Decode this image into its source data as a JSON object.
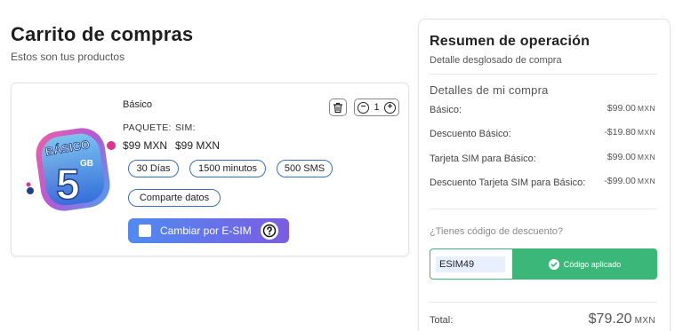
{
  "header": {
    "title": "Carrito de compras",
    "subtitle": "Estos son tus productos"
  },
  "product": {
    "name": "Básico",
    "image_text": {
      "line1": "BÁSICO",
      "big": "5",
      "unit": "GB"
    },
    "quantity": "1",
    "package_label": "PAQUETE:",
    "package_price": "$99 MXN",
    "sim_label": "SIM:",
    "sim_price": "$99 MXN",
    "features": [
      "30 Días",
      "1500 minutos",
      "500 SMS",
      "Comparte datos"
    ],
    "esim_label": "Cambiar por E-SIM",
    "esim_checked": false
  },
  "summary": {
    "title": "Resumen de operación",
    "subtitle": "Detalle desglosado de compra",
    "details_title": "Detalles de mi compra",
    "lines": [
      {
        "label": "Básico:",
        "amount": "$99.00",
        "currency": "MXN"
      },
      {
        "label": "Descuento Básico:",
        "amount": "-$19.80",
        "currency": "MXN"
      },
      {
        "label": "Tarjeta SIM para Básico:",
        "amount": "$99.00",
        "currency": "MXN"
      },
      {
        "label": "Descuento Tarjeta SIM para Básico:",
        "amount": "-$99.00",
        "currency": "MXN"
      }
    ],
    "discount_question": "¿Tienes código de descuento?",
    "coupon_value": "ESIM49",
    "coupon_status": "Código aplicado",
    "total_label": "Total:",
    "total_amount": "$79.20",
    "total_currency": "MXN"
  },
  "colors": {
    "accent_green": "#3bb879",
    "chip_border": "#3b6dc1",
    "esim_gradient_start": "#4f8bf1",
    "esim_gradient_end": "#7c5ce0",
    "dot_pink": "#e0338f",
    "dot_navy": "#1f3f8a"
  },
  "icons": {
    "trash": "trash-icon",
    "minus": "minus-circle-icon",
    "plus": "plus-circle-icon",
    "help": "question-circle-icon",
    "check": "check-circle-icon"
  }
}
